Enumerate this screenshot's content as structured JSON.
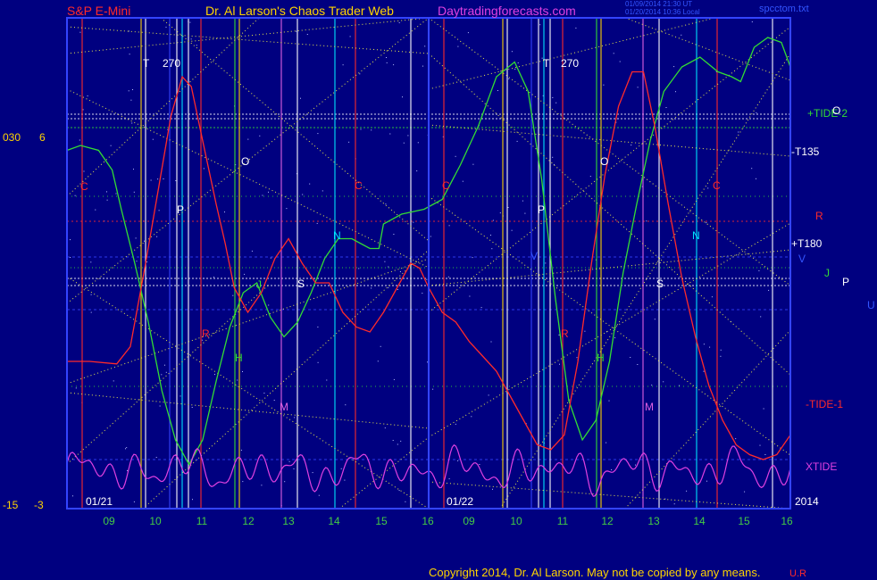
{
  "header": {
    "instrument": "S&P E-Mini",
    "publisher": "Dr. Al Larson's Chaos Trader Web",
    "site": "Daytradingforecasts.com",
    "stamp_line1": "01/09/2014 21:30 UT",
    "stamp_line2": "01/20/2014 10:36 Local",
    "file": "spcctom.txt"
  },
  "footer": {
    "copyright": "Copyright 2014, Dr. Al Larson. May not be copied by any means.",
    "corner": "U.R"
  },
  "left_axis": {
    "top_a": "030",
    "top_b": "6",
    "bottom_a": "-15",
    "bottom_b": "-3"
  },
  "right_labels": {
    "tide2": "+TIDE-2",
    "o": "O",
    "t135": "-T135",
    "r": "R",
    "t180": "+T180",
    "v": "V",
    "j": "J",
    "p": "P",
    "u": "U",
    "tide1": "-TIDE-1",
    "xtide": "XTIDE",
    "year": "2014"
  },
  "colors": {
    "background": "#000080",
    "frame": "#3344ff",
    "tide1": "#ff2a2a",
    "tide2": "#33dd33",
    "xtide": "#e040e0",
    "trendlines": "#e8e84a",
    "cyan": "#00e5ff",
    "white": "#ffffff",
    "magenta": "#e060e0",
    "yellow": "#ffd400",
    "green_text": "#44cc44"
  },
  "chart_data": {
    "type": "line",
    "title": "S&P E-Mini",
    "days": [
      {
        "date": "01/21",
        "hours": [
          "09",
          "10",
          "11",
          "12",
          "13",
          "14",
          "15",
          "16"
        ]
      },
      {
        "date": "01/22",
        "hours": [
          "09",
          "10",
          "11",
          "12",
          "13",
          "14",
          "15",
          "16"
        ]
      }
    ],
    "x_range": [
      0,
      16
    ],
    "y_range": [
      0,
      100
    ],
    "tide1": [
      [
        0.0,
        30
      ],
      [
        0.5,
        30
      ],
      [
        1.1,
        29.5
      ],
      [
        1.4,
        33
      ],
      [
        1.7,
        48
      ],
      [
        2.0,
        64
      ],
      [
        2.3,
        80
      ],
      [
        2.55,
        88
      ],
      [
        2.75,
        86
      ],
      [
        3.0,
        75
      ],
      [
        3.3,
        62
      ],
      [
        3.5,
        54
      ],
      [
        3.7,
        45
      ],
      [
        4.0,
        40
      ],
      [
        4.3,
        44
      ],
      [
        4.6,
        51
      ],
      [
        4.9,
        55
      ],
      [
        5.2,
        50
      ],
      [
        5.5,
        46
      ],
      [
        5.8,
        46
      ],
      [
        6.1,
        40
      ],
      [
        6.4,
        37
      ],
      [
        6.7,
        36
      ],
      [
        7.0,
        40
      ],
      [
        7.3,
        45
      ],
      [
        7.6,
        50
      ],
      [
        7.8,
        49
      ],
      [
        8.0,
        45
      ],
      [
        8.3,
        40
      ],
      [
        8.6,
        38
      ],
      [
        8.9,
        34
      ],
      [
        9.2,
        31
      ],
      [
        9.5,
        28
      ],
      [
        9.8,
        23
      ],
      [
        10.1,
        18
      ],
      [
        10.4,
        13
      ],
      [
        10.7,
        12
      ],
      [
        11.0,
        15
      ],
      [
        11.3,
        30
      ],
      [
        11.6,
        50
      ],
      [
        11.9,
        68
      ],
      [
        12.2,
        82
      ],
      [
        12.5,
        89
      ],
      [
        12.75,
        89
      ],
      [
        13.0,
        78
      ],
      [
        13.3,
        62
      ],
      [
        13.6,
        47
      ],
      [
        13.9,
        35
      ],
      [
        14.2,
        25
      ],
      [
        14.5,
        18
      ],
      [
        14.8,
        13
      ],
      [
        15.1,
        11
      ],
      [
        15.4,
        10
      ],
      [
        15.7,
        11
      ],
      [
        16.0,
        15
      ]
    ],
    "tide2": [
      [
        0.0,
        73
      ],
      [
        0.3,
        74
      ],
      [
        0.7,
        73
      ],
      [
        1.0,
        69
      ],
      [
        1.2,
        61
      ],
      [
        1.5,
        50
      ],
      [
        1.8,
        38
      ],
      [
        2.1,
        24
      ],
      [
        2.4,
        14
      ],
      [
        2.7,
        9
      ],
      [
        3.0,
        14
      ],
      [
        3.3,
        26
      ],
      [
        3.6,
        37
      ],
      [
        3.9,
        44
      ],
      [
        4.2,
        46
      ],
      [
        4.5,
        39
      ],
      [
        4.8,
        35
      ],
      [
        5.1,
        38
      ],
      [
        5.4,
        44
      ],
      [
        5.7,
        51
      ],
      [
        6.0,
        55
      ],
      [
        6.3,
        55
      ],
      [
        6.7,
        53
      ],
      [
        6.9,
        53
      ],
      [
        7.0,
        58
      ],
      [
        7.4,
        60
      ],
      [
        7.9,
        61
      ],
      [
        8.3,
        63
      ],
      [
        8.7,
        70
      ],
      [
        9.1,
        78
      ],
      [
        9.5,
        88
      ],
      [
        9.9,
        91
      ],
      [
        10.2,
        85
      ],
      [
        10.5,
        67
      ],
      [
        10.8,
        43
      ],
      [
        11.1,
        22
      ],
      [
        11.4,
        14
      ],
      [
        11.7,
        18
      ],
      [
        12.0,
        30
      ],
      [
        12.3,
        48
      ],
      [
        12.6,
        62
      ],
      [
        12.9,
        75
      ],
      [
        13.2,
        85
      ],
      [
        13.6,
        90
      ],
      [
        14.0,
        92
      ],
      [
        14.4,
        89
      ],
      [
        14.7,
        88
      ],
      [
        14.9,
        87
      ],
      [
        15.2,
        94
      ],
      [
        15.5,
        96
      ],
      [
        15.8,
        95
      ],
      [
        16.0,
        90
      ]
    ],
    "markers": [
      {
        "label": "T",
        "color": "#ffffff"
      },
      {
        "label": "270",
        "color": "#ffffff"
      },
      {
        "label": "T",
        "color": "#ffffff"
      },
      {
        "label": "270",
        "color": "#ffffff"
      },
      {
        "label": "O",
        "color": "#ffffff"
      },
      {
        "label": "O",
        "color": "#ffffff"
      },
      {
        "label": "C",
        "color": "#ff2a2a"
      },
      {
        "label": "C",
        "color": "#ff2a2a"
      },
      {
        "label": "C",
        "color": "#ff2a2a"
      },
      {
        "label": "C",
        "color": "#ff2a2a"
      },
      {
        "label": "P",
        "color": "#ffffff"
      },
      {
        "label": "P",
        "color": "#ffffff"
      },
      {
        "label": "N",
        "color": "#00e5ff"
      },
      {
        "label": "N",
        "color": "#00e5ff"
      },
      {
        "label": "S",
        "color": "#ffffff"
      },
      {
        "label": "S",
        "color": "#ffffff"
      },
      {
        "label": "R",
        "color": "#ff2a2a"
      },
      {
        "label": "R",
        "color": "#ff2a2a"
      },
      {
        "label": "H",
        "color": "#33dd33"
      },
      {
        "label": "H",
        "color": "#33dd33"
      },
      {
        "label": "M",
        "color": "#e060e0"
      },
      {
        "label": "M",
        "color": "#e060e0"
      },
      {
        "label": "V",
        "color": "#3355ff"
      },
      {
        "label": "J",
        "color": "#33dd33"
      }
    ]
  }
}
